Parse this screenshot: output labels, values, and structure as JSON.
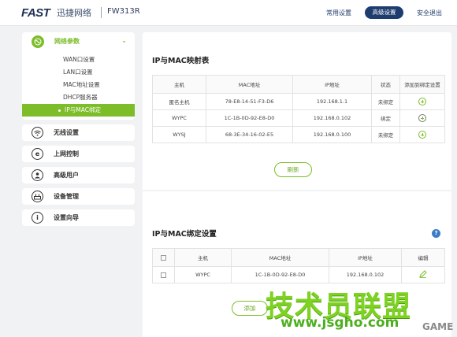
{
  "header": {
    "logo": "FAST",
    "brand_cn": "迅捷网络",
    "model": "FW313R",
    "nav_common": "常用设置",
    "nav_advanced": "高级设置",
    "nav_logout": "安全退出"
  },
  "sidebar": {
    "network": {
      "label": "网络参数",
      "subitems": [
        "WAN口设置",
        "LAN口设置",
        "MAC地址设置",
        "DHCP服务器",
        "IP与MAC绑定"
      ]
    },
    "items": [
      {
        "label": "无线设置",
        "icon": "wifi-icon"
      },
      {
        "label": "上网控制",
        "icon": "internet-icon"
      },
      {
        "label": "高级用户",
        "icon": "users-icon"
      },
      {
        "label": "设备管理",
        "icon": "router-icon"
      },
      {
        "label": "设置向导",
        "icon": "info-icon"
      }
    ]
  },
  "map_table": {
    "title": "IP与MAC映射表",
    "headers": [
      "主机",
      "MAC地址",
      "IP地址",
      "状态",
      "添加到绑定设置"
    ],
    "rows": [
      {
        "host": "匿名主机",
        "mac": "78-E8-14-51-F3-D6",
        "ip": "192.168.1.1",
        "status": "未绑定"
      },
      {
        "host": "WYPC",
        "mac": "1C-1B-0D-92-E8-D0",
        "ip": "192.168.0.102",
        "status": "绑定"
      },
      {
        "host": "WYSJ",
        "mac": "68-3E-34-16-02-E5",
        "ip": "192.168.0.100",
        "status": "未绑定"
      }
    ],
    "refresh": "刷新"
  },
  "bind_table": {
    "title": "IP与MAC绑定设置",
    "headers": [
      "主机",
      "MAC地址",
      "IP地址",
      "编辑"
    ],
    "rows": [
      {
        "host": "WYPC",
        "mac": "1C-1B-0D-92-E8-D0",
        "ip": "192.168.0.102"
      }
    ],
    "add": "添加"
  },
  "watermark": {
    "cn": "技术员联盟",
    "url": "www.jsgho.com",
    "game": "GAME"
  },
  "colors": {
    "accent": "#7dbd2a",
    "nav_dark": "#1e3d6f"
  }
}
